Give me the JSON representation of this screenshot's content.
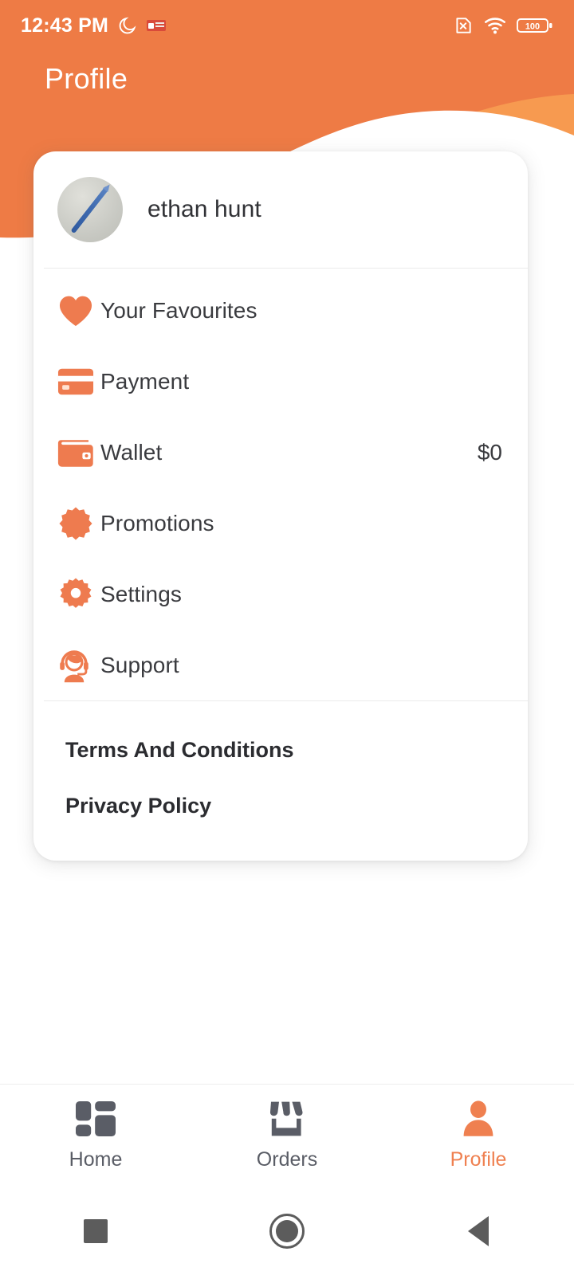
{
  "theme": {
    "primary_orange": "#ee7b45",
    "light_orange": "#f79a50",
    "accent_text": "#ef8050",
    "card_bg": "#ffffff",
    "text_dark": "#3a3b3f"
  },
  "status_bar": {
    "time": "12:43 PM",
    "icons": [
      "crescent-moon-icon",
      "notification-badge-icon",
      "sim-disabled-icon",
      "wifi-icon",
      "battery-icon"
    ],
    "battery_level": "100"
  },
  "header": {
    "title": "Profile"
  },
  "profile": {
    "name": "ethan hunt",
    "avatar": "user-avatar-photo"
  },
  "menu": {
    "items": [
      {
        "label": "Your Favourites",
        "icon": "heart-icon",
        "value": ""
      },
      {
        "label": "Payment",
        "icon": "credit-card-icon",
        "value": ""
      },
      {
        "label": "Wallet",
        "icon": "wallet-icon",
        "value": "$0"
      },
      {
        "label": "Promotions",
        "icon": "badge-burst-icon",
        "value": ""
      },
      {
        "label": "Settings",
        "icon": "gear-icon",
        "value": ""
      },
      {
        "label": "Support",
        "icon": "headset-agent-icon",
        "value": ""
      }
    ]
  },
  "legal": {
    "items": [
      {
        "label": "Terms And Conditions"
      },
      {
        "label": "Privacy Policy"
      }
    ]
  },
  "bottom_nav": {
    "tabs": [
      {
        "label": "Home",
        "icon": "dashboard-grid-icon",
        "active": false
      },
      {
        "label": "Orders",
        "icon": "storefront-icon",
        "active": false
      },
      {
        "label": "Profile",
        "icon": "person-icon",
        "active": true
      }
    ]
  },
  "android_nav": {
    "buttons": [
      "recents-square-icon",
      "home-circle-icon",
      "back-triangle-icon"
    ]
  }
}
